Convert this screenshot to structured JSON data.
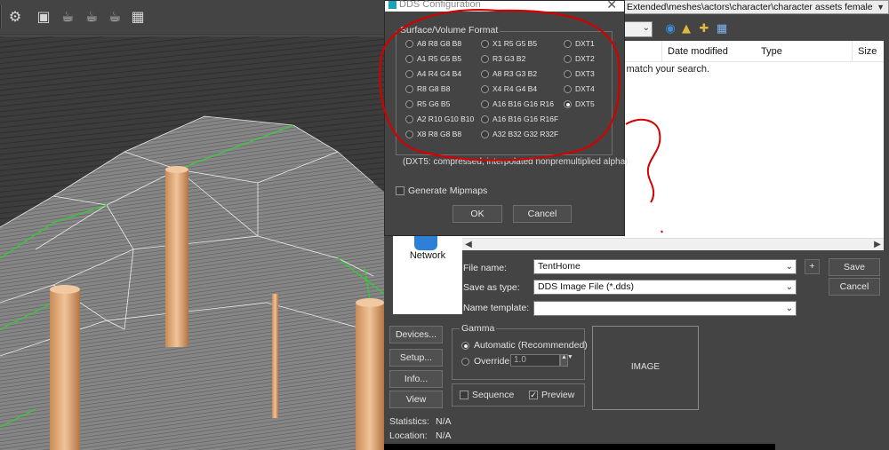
{
  "dds": {
    "title": "DDS Configuration",
    "close_glyph": "✕",
    "group_title": "Surface/Volume Format",
    "formats": [
      {
        "label": "A8 R8 G8 B8",
        "selected": false
      },
      {
        "label": "A1 R5 G5 B5",
        "selected": false
      },
      {
        "label": "A4 R4 G4 B4",
        "selected": false
      },
      {
        "label": "R8 G8 B8",
        "selected": false
      },
      {
        "label": "R5 G6 B5",
        "selected": false
      },
      {
        "label": "A2 R10 G10 B10",
        "selected": false
      },
      {
        "label": "X8 R8 G8 B8",
        "selected": false
      },
      {
        "label": "X1 R5 G5 B5",
        "selected": false
      },
      {
        "label": "R3 G3 B2",
        "selected": false
      },
      {
        "label": "A8 R3 G3 B2",
        "selected": false
      },
      {
        "label": "X4 R4 G4 B4",
        "selected": false
      },
      {
        "label": "A16 B16 G16 R16",
        "selected": false
      },
      {
        "label": "A16 B16 G16 R16F",
        "selected": false
      },
      {
        "label": "A32 B32 G32 R32F",
        "selected": false
      },
      {
        "label": "DXT1",
        "selected": false
      },
      {
        "label": "DXT2",
        "selected": false
      },
      {
        "label": "DXT3",
        "selected": false
      },
      {
        "label": "DXT4",
        "selected": false
      },
      {
        "label": "DXT5",
        "selected": true
      }
    ],
    "description": "(DXT5: compressed, interpolated nonpremultiplied alpha)",
    "mipmaps_label": "Generate Mipmaps",
    "mipmaps_checked": false,
    "ok_label": "OK",
    "cancel_label": "Cancel"
  },
  "file_dialog": {
    "path": "Extended\\meshes\\actors\\character\\character assets female",
    "columns": [
      "Date modified",
      "Type",
      "Size"
    ],
    "empty_message": "o items match your search.",
    "network_label": "Network",
    "file_name_label": "File name:",
    "file_name_value": "TentHome",
    "save_type_label": "Save as type:",
    "save_type_value": "DDS Image File (*.dds)",
    "name_template_label": "Name template:",
    "name_template_value": "",
    "plus_label": "+",
    "save_label": "Save",
    "cancel_label": "Cancel"
  },
  "render_panel": {
    "devices_label": "Devices...",
    "setup_label": "Setup...",
    "info_label": "Info...",
    "view_label": "View",
    "gamma_title": "Gamma",
    "gamma_auto_label": "Automatic (Recommended)",
    "gamma_override_label": "Override",
    "gamma_override_value": "1.0",
    "sequence_label": "Sequence",
    "sequence_checked": false,
    "preview_label": "Preview",
    "preview_checked": true,
    "image_label": "IMAGE",
    "statistics_label": "Statistics:",
    "statistics_value": "N/A",
    "location_label": "Location:",
    "location_value": "N/A"
  },
  "colors": {
    "viewport_bg": "#5a5a5a",
    "dialog_bg": "#444444",
    "annotation_red": "#d40000",
    "selection_green": "#2ed12e",
    "column_orange": "#d9a06b"
  }
}
